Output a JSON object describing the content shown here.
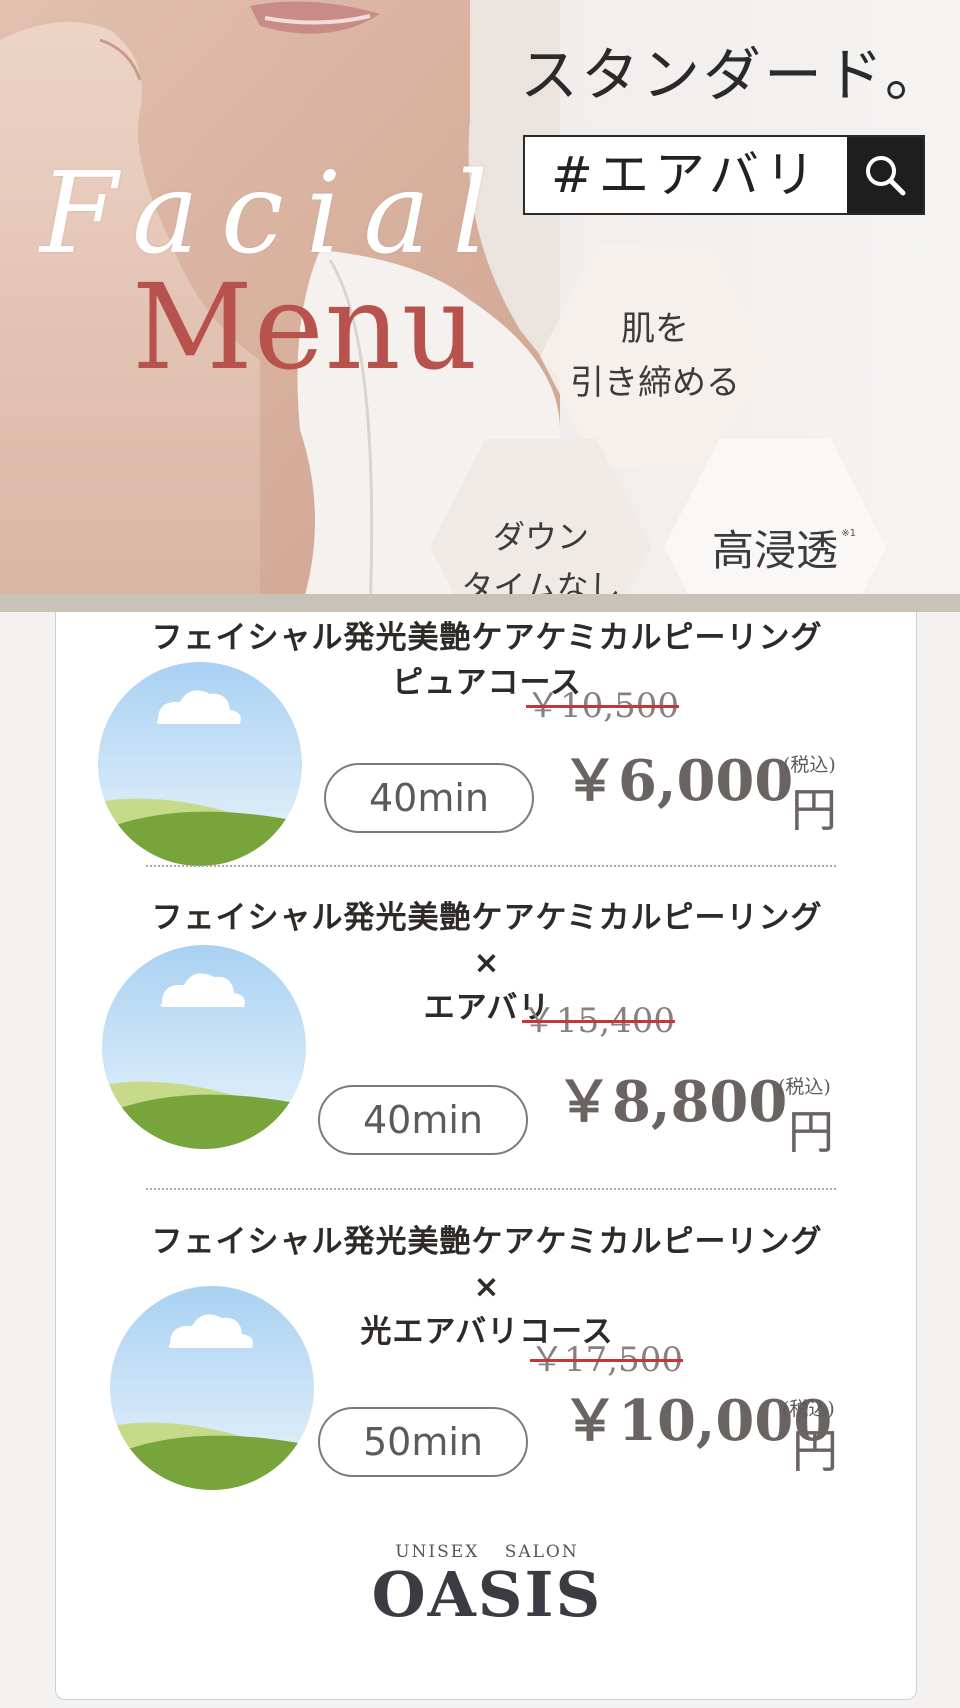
{
  "hero": {
    "title": "スタンダード。",
    "search_text": "#エアバリ",
    "script_top": "Facial",
    "script_bottom": "Menu",
    "hex1": "肌を\n引き締める",
    "hex2": "ダウン\nタイムなし",
    "hex3": "高浸透",
    "hex3_note": "※1",
    "icons": [
      "search-icon"
    ]
  },
  "menu": [
    {
      "title": "フェイシャル発光美艶ケアケミカルピーリング\nピュアコース",
      "duration": "40min",
      "old_price": "￥10,500",
      "price": "￥6,000",
      "tax_label": "(税込)",
      "unit": "円"
    },
    {
      "title": "フェイシャル発光美艶ケアケミカルピーリング\n×\nエアバリ",
      "duration": "40min",
      "old_price": "￥15,400",
      "price": "￥8,800",
      "tax_label": "(税込)",
      "unit": "円"
    },
    {
      "title": "フェイシャル発光美艶ケアケミカルピーリング\n×\n光エアバリコース",
      "duration": "50min",
      "old_price": "￥17,500",
      "price": "￥10,000",
      "tax_label": "(税込)",
      "unit": "円"
    }
  ],
  "brand": {
    "sub": "UNISEX SALON",
    "name": "OASIS"
  },
  "colors": {
    "accent_red": "#b8524c",
    "strike_red": "#c2373a",
    "price_gray": "#6b6362",
    "search_button": "#1e1e1e"
  }
}
